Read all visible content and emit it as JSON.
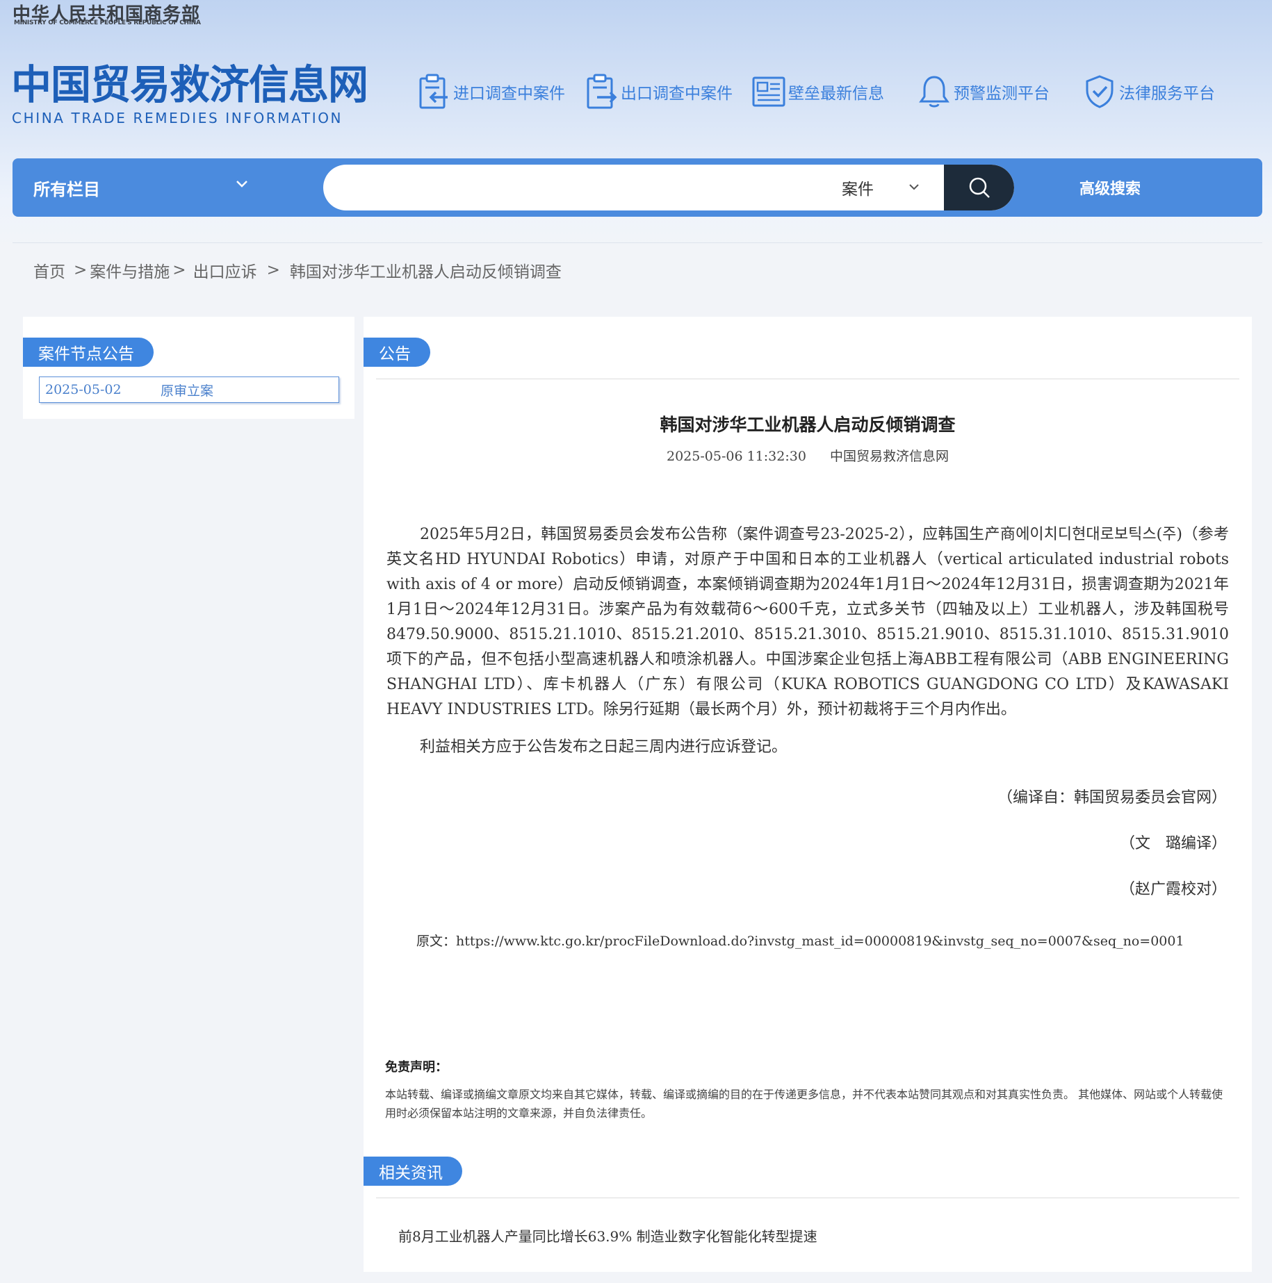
{
  "header": {
    "ministry_cn": "中华人民共和国商务部",
    "ministry_en": "MINISTRY OF COMMERCE PEOPLE'S REPUBLIC OF CHINA",
    "site_cn": "中国贸易救济信息网",
    "site_en": "CHINA TRADE REMEDIES INFORMATION",
    "nav": [
      {
        "label": "进口调查中案件",
        "icon": "clipboard-import-icon"
      },
      {
        "label": "出口调查中案件",
        "icon": "clipboard-export-icon"
      },
      {
        "label": "壁垒最新信息",
        "icon": "newspaper-icon"
      },
      {
        "label": "预警监测平台",
        "icon": "bell-icon"
      },
      {
        "label": "法律服务平台",
        "icon": "shield-check-icon"
      }
    ]
  },
  "search": {
    "category": "所有栏目",
    "query": "",
    "type": "案件",
    "advanced_label": "高级搜索"
  },
  "breadcrumb": {
    "home": "首页",
    "level1": "案件与措施",
    "level2": "出口应诉",
    "current": "韩国对涉华工业机器人启动反倾销调查"
  },
  "sidebar": {
    "title": "案件节点公告",
    "items": [
      {
        "date": "2025-05-02",
        "label": "原审立案"
      }
    ]
  },
  "article": {
    "section_label": "公告",
    "title": "韩国对涉华工业机器人启动反倾销调查",
    "datetime": "2025-05-06 11:32:30",
    "source": "中国贸易救济信息网",
    "paragraph1": "2025年5月2日，韩国贸易委员会发布公告称（案件调查号23-2025-2），应韩国生产商에이치디현대로보틱스(주)（参考英文名HD HYUNDAI Robotics）申请，对原产于中国和日本的工业机器人（vertical articulated industrial robots with axis of 4 or more）启动反倾销调查，本案倾销调查期为2024年1月1日～2024年12月31日，损害调查期为2021年1月1日～2024年12月31日。涉案产品为有效载荷6～600千克，立式多关节（四轴及以上）工业机器人，涉及韩国税号8479.50.9000、8515.21.1010、8515.21.2010、8515.21.3010、8515.21.9010、8515.31.1010、8515.31.9010项下的产品，但不包括小型高速机器人和喷涂机器人。中国涉案企业包括上海ABB工程有限公司（ABB ENGINEERING SHANGHAI LTD）、库卡机器人（广东）有限公司（KUKA ROBOTICS GUANGDONG CO LTD）及KAWASAKI HEAVY INDUSTRIES LTD。除另行延期（最长两个月）外，预计初裁将于三个月内作出。",
    "paragraph2": "利益相关方应于公告发布之日起三周内进行应诉登记。",
    "compiled_from": "（编译自：韩国贸易委员会官网）",
    "translator": "（文　璐编译）",
    "proofreader": "（赵广霞校对）",
    "original_url": "原文：https://www.ktc.go.kr/procFileDownload.do?invstg_mast_id=00000819&invstg_seq_no=0007&seq_no=0001",
    "disclaimer_title": "免责声明：",
    "disclaimer_text": "本站转载、编译或摘编文章原文均来自其它媒体，转载、编译或摘编的目的在于传递更多信息，并不代表本站赞同其观点和对其真实性负责。 其他媒体、网站或个人转载使用时必须保留本站注明的文章来源，并自负法律责任。"
  },
  "related": {
    "section_label": "相关资讯",
    "items": [
      {
        "title": "前8月工业机器人产量同比增长63.9% 制造业数字化智能化转型提速"
      }
    ]
  },
  "colors": {
    "primary_blue": "#4b8bde",
    "brand_blue": "#1d5fb8",
    "tab_blue": "#3f86e0",
    "search_button": "#1d2b3a"
  }
}
